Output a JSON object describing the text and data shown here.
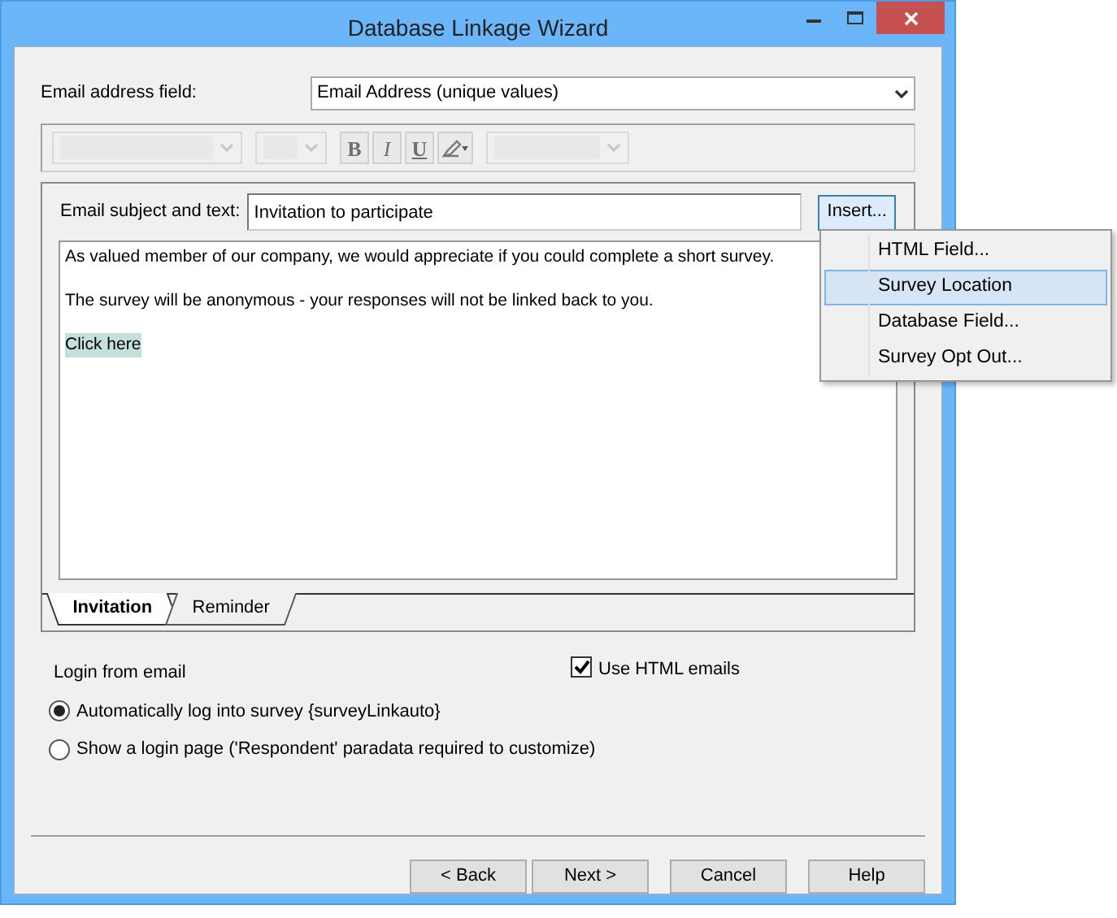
{
  "window": {
    "title": "Database Linkage Wizard"
  },
  "email_field": {
    "label": "Email address field:",
    "value": "Email Address (unique values)"
  },
  "format_toolbar": {
    "buttons": [
      {
        "kind": "bold",
        "label": "B"
      },
      {
        "kind": "italic",
        "label": "I"
      },
      {
        "kind": "underline",
        "label": "U"
      }
    ]
  },
  "subject": {
    "label": "Email subject and text:",
    "value": "Invitation to participate"
  },
  "insert_button": {
    "label": "Insert..."
  },
  "insert_menu": [
    {
      "label": "HTML Field...",
      "selected": false
    },
    {
      "label": "Survey Location",
      "selected": true
    },
    {
      "label": "Database Field...",
      "selected": false
    },
    {
      "label": "Survey Opt Out...",
      "selected": false
    }
  ],
  "body": [
    {
      "kind": "text",
      "text": "As valued member of our company, we would appreciate if you could complete a short survey."
    },
    {
      "kind": "text",
      "text": "The survey will be anonymous - your responses will not be linked back to you."
    },
    {
      "kind": "link",
      "text": "Click here"
    }
  ],
  "tabs": [
    {
      "label": "Invitation",
      "selected": true
    },
    {
      "label": "Reminder",
      "selected": false
    }
  ],
  "login": {
    "label": "Login from email",
    "options": [
      {
        "label": "Automatically log into survey {surveyLinkauto}",
        "selected": true
      },
      {
        "label": "Show a login page ('Respondent' paradata required to customize)",
        "selected": false
      }
    ]
  },
  "html_checkbox": {
    "label": "Use HTML emails",
    "checked": true
  },
  "buttons": [
    {
      "label": "< Back"
    },
    {
      "label": "Next >"
    },
    {
      "label": "Cancel"
    },
    {
      "label": "Help"
    }
  ]
}
